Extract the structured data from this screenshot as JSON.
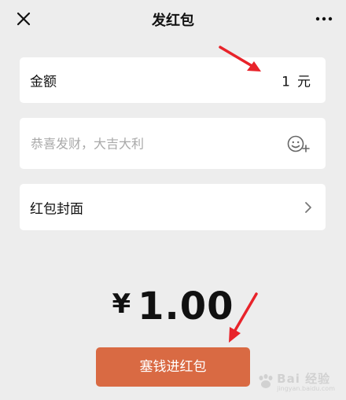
{
  "header": {
    "title": "发红包",
    "close_icon": "close-icon",
    "more_icon": "more-icon"
  },
  "amount": {
    "label": "金额",
    "value": "1",
    "unit": "元"
  },
  "greeting": {
    "placeholder": "恭喜发财，大吉大利",
    "emoji_icon": "emoji-add-icon"
  },
  "cover": {
    "label": "红包封面",
    "chevron_icon": "chevron-right-icon"
  },
  "total": {
    "currency": "¥",
    "value": "1.00"
  },
  "submit": {
    "label": "塞钱进红包",
    "color": "#d96a43"
  },
  "annotation": {
    "arrow_color": "#e8232a"
  },
  "watermark": {
    "brand": "Bai",
    "text": "经验",
    "sub": "jingyan.baidu.com"
  }
}
